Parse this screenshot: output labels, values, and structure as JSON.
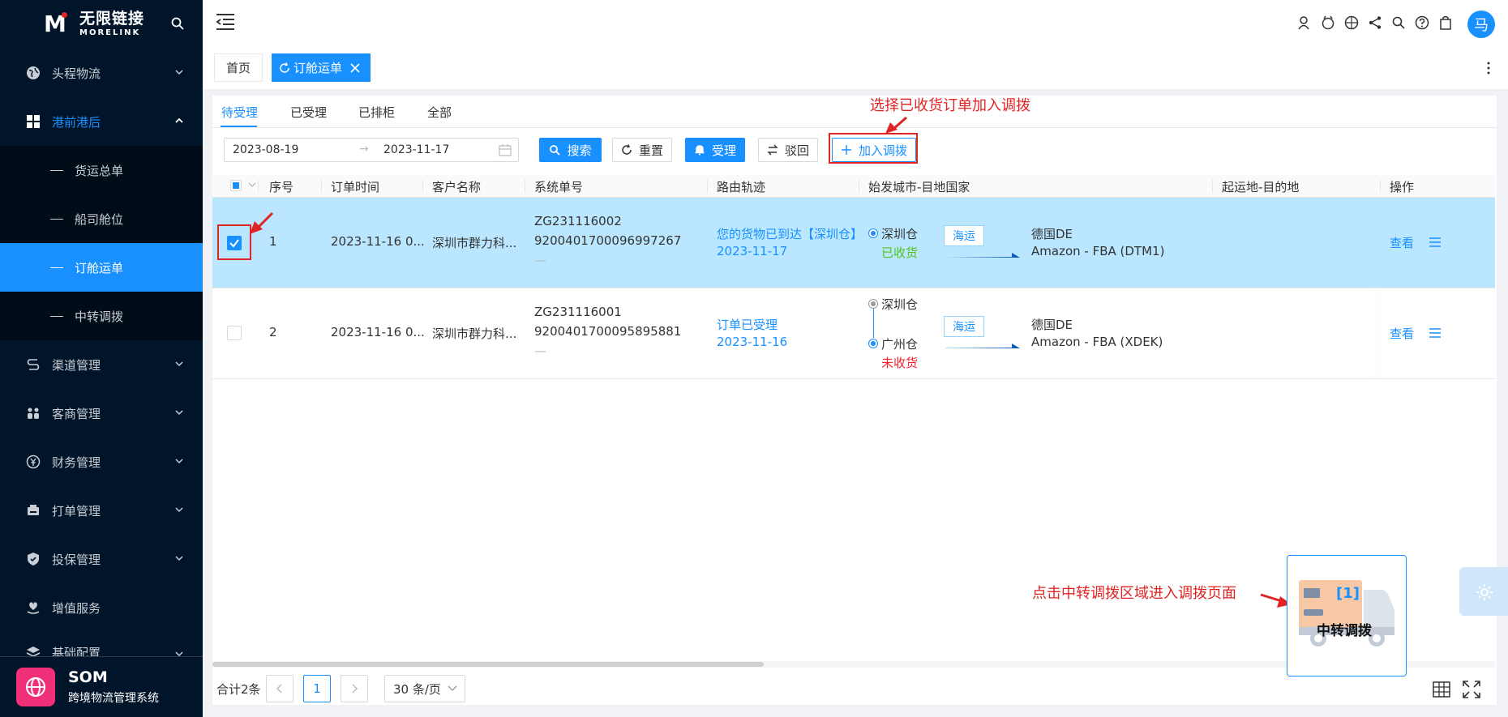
{
  "brand": {
    "logo_cn": "无限链接",
    "logo_en": "MORELINK",
    "app_name": "SOM",
    "app_subtitle": "跨境物流管理系统"
  },
  "sidebar": {
    "items": [
      {
        "label": "头程物流",
        "icon": "globe-icon"
      },
      {
        "label": "港前港后",
        "icon": "grid-icon"
      },
      {
        "label": "渠道管理",
        "icon": "route-icon"
      },
      {
        "label": "客商管理",
        "icon": "people-icon"
      },
      {
        "label": "财务管理",
        "icon": "yen-icon"
      },
      {
        "label": "打单管理",
        "icon": "printer-icon"
      },
      {
        "label": "投保管理",
        "icon": "shield-icon"
      },
      {
        "label": "增值服务",
        "icon": "heart-hand-icon"
      },
      {
        "label": "基础配置",
        "icon": "layers-icon"
      }
    ],
    "sub_items": [
      "货运总单",
      "船司舱位",
      "订舱运单",
      "中转调拨"
    ],
    "selected_sub": "订舱运单"
  },
  "header": {
    "avatar_text": "马"
  },
  "tabs": {
    "home": "首页",
    "current": "订舱运单"
  },
  "subtabs": [
    "待受理",
    "已受理",
    "已排柜",
    "全部"
  ],
  "filters": {
    "date_start": "2023-08-19",
    "date_end": "2023-11-17",
    "search_label": "搜索",
    "reset_label": "重置",
    "accept_label": "受理",
    "reject_label": "驳回",
    "add_transfer_label": "加入调拨"
  },
  "table": {
    "columns": [
      "序号",
      "订单时间",
      "客户名称",
      "系统单号",
      "路由轨迹",
      "始发城市-目地国家",
      "起运地-目的地",
      "操作"
    ],
    "rows": [
      {
        "index": "1",
        "order_time": "2023-11-16 0...",
        "customer": "深圳市群力科...",
        "sys_no_1": "ZG231116002",
        "sys_no_2": "9200401700096997267",
        "sys_no_3": "—",
        "route_status": "您的货物已到达【深圳仓】",
        "route_date": "2023-11-17",
        "origin_1": "深圳仓",
        "origin_1_status": "已收货",
        "transport": "海运",
        "dest_country": "德国DE",
        "dest_wh": "Amazon - FBA (DTM1)",
        "action_view": "查看",
        "checked": true
      },
      {
        "index": "2",
        "order_time": "2023-11-16 0...",
        "customer": "深圳市群力科...",
        "sys_no_1": "ZG231116001",
        "sys_no_2": "9200401700095895881",
        "sys_no_3": "—",
        "route_status": "订单已受理",
        "route_date": "2023-11-16",
        "origin_1": "深圳仓",
        "origin_2": "广州仓",
        "origin_2_status": "未收货",
        "transport": "海运",
        "dest_country": "德国DE",
        "dest_wh": "Amazon - FBA (XDEK)",
        "action_view": "查看",
        "checked": false
      }
    ]
  },
  "pager": {
    "total": "合计2条",
    "current_page": "1",
    "page_size": "30 条/页"
  },
  "annotations": {
    "top": "选择已收货订单加入调拨",
    "bottom": "点击中转调拨区域进入调拨页面"
  },
  "transfer_widget": {
    "count": "[1]",
    "label": "中转调拨"
  },
  "colors": {
    "primary": "#1890ff",
    "sidebar_bg": "#001529",
    "annotation_red": "#e02424",
    "selected_row": "#bae7ff"
  }
}
